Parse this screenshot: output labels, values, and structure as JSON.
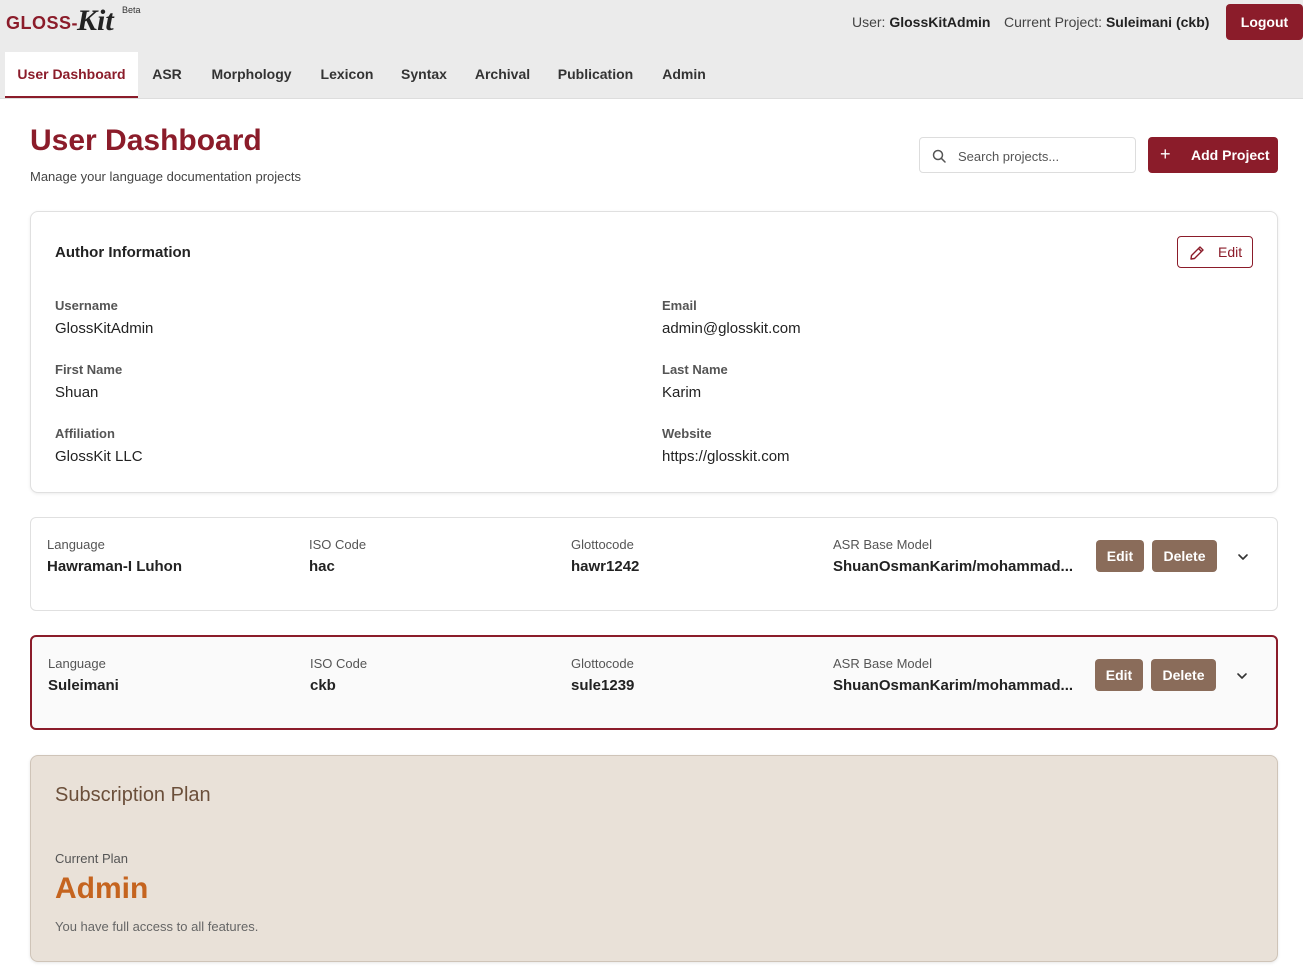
{
  "app": {
    "logo_main": "GLOSS-",
    "logo_script": "Kit",
    "logo_badge": "Beta"
  },
  "header": {
    "user_label": "User:",
    "user_name": "GlossKitAdmin",
    "project_label": "Current Project:",
    "project_name": "Suleimani (ckb)",
    "logout_label": "Logout"
  },
  "tabs": [
    {
      "label": "User Dashboard",
      "active": true
    },
    {
      "label": "ASR"
    },
    {
      "label": "Morphology"
    },
    {
      "label": "Lexicon"
    },
    {
      "label": "Syntax"
    },
    {
      "label": "Archival"
    },
    {
      "label": "Publication"
    },
    {
      "label": "Admin"
    }
  ],
  "page": {
    "title": "User Dashboard",
    "subtitle": "Manage your language documentation projects",
    "search_placeholder": "Search projects...",
    "add_label": "Add Project"
  },
  "author": {
    "title": "Author Information",
    "edit_label": "Edit",
    "fields": [
      {
        "label": "Username",
        "value": "GlossKitAdmin"
      },
      {
        "label": "Email",
        "value": "admin@glosskit.com"
      },
      {
        "label": "First Name",
        "value": "Shuan"
      },
      {
        "label": "Last Name",
        "value": "Karim"
      },
      {
        "label": "Affiliation",
        "value": "GlossKit LLC"
      },
      {
        "label": "Website",
        "value": "https://glosskit.com"
      }
    ]
  },
  "languages": {
    "col_labels": [
      "Language",
      "ISO Code",
      "Glottocode",
      "ASR Base Model"
    ],
    "edit_label": "Edit",
    "delete_label": "Delete",
    "rows": [
      {
        "language": "Hawraman-I Luhon",
        "iso": "hac",
        "glottocode": "hawr1242",
        "asr": "ShuanOsmanKarim/mohammad...",
        "selected": false
      },
      {
        "language": "Suleimani",
        "iso": "ckb",
        "glottocode": "sule1239",
        "asr": "ShuanOsmanKarim/mohammad...",
        "selected": true
      }
    ]
  },
  "subscription": {
    "title": "Subscription Plan",
    "current_label": "Current Plan",
    "plan": "Admin",
    "description": "You have full access to all features."
  },
  "colors": {
    "brand": "#8b1c2a",
    "brown_button": "#8a6c5a",
    "plan_accent": "#c5641f",
    "subscription_bg": "#e9e1d8"
  }
}
